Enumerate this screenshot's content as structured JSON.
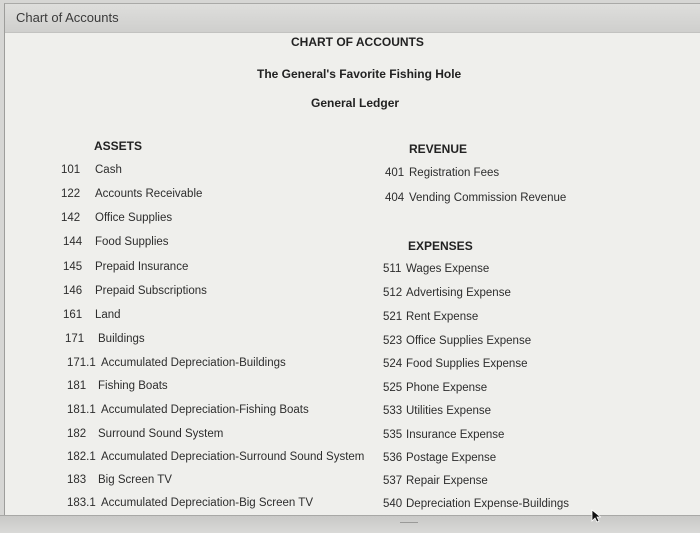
{
  "window": {
    "title": "Chart of Accounts"
  },
  "header": {
    "title": "CHART OF ACCOUNTS",
    "company": "The General's Favorite Fishing Hole",
    "ledger": "General Ledger"
  },
  "assets": {
    "heading": "ASSETS",
    "items": [
      {
        "num": "101",
        "name": "Cash"
      },
      {
        "num": "122",
        "name": "Accounts Receivable"
      },
      {
        "num": "142",
        "name": "Office Supplies"
      },
      {
        "num": "144",
        "name": "Food Supplies"
      },
      {
        "num": "145",
        "name": "Prepaid Insurance"
      },
      {
        "num": "146",
        "name": "Prepaid Subscriptions"
      },
      {
        "num": "161",
        "name": "Land"
      },
      {
        "num": "171",
        "name": "Buildings"
      },
      {
        "num": "171.1",
        "name": "Accumulated Depreciation-Buildings"
      },
      {
        "num": "181",
        "name": "Fishing Boats"
      },
      {
        "num": "181.1",
        "name": "Accumulated Depreciation-Fishing Boats"
      },
      {
        "num": "182",
        "name": "Surround Sound System"
      },
      {
        "num": "182.1",
        "name": "Accumulated Depreciation-Surround Sound System"
      },
      {
        "num": "183",
        "name": "Big Screen TV"
      },
      {
        "num": "183.1",
        "name": "Accumulated Depreciation-Big Screen TV"
      }
    ]
  },
  "revenue": {
    "heading": "REVENUE",
    "items": [
      {
        "num": "401",
        "name": "Registration Fees"
      },
      {
        "num": "404",
        "name": "Vending Commission Revenue"
      }
    ]
  },
  "expenses": {
    "heading": "EXPENSES",
    "items": [
      {
        "num": "511",
        "name": "Wages Expense"
      },
      {
        "num": "512",
        "name": "Advertising Expense"
      },
      {
        "num": "521",
        "name": "Rent Expense"
      },
      {
        "num": "523",
        "name": "Office Supplies Expense"
      },
      {
        "num": "524",
        "name": "Food Supplies Expense"
      },
      {
        "num": "525",
        "name": "Phone Expense"
      },
      {
        "num": "533",
        "name": "Utilities Expense"
      },
      {
        "num": "535",
        "name": "Insurance Expense"
      },
      {
        "num": "536",
        "name": "Postage Expense"
      },
      {
        "num": "537",
        "name": "Repair Expense"
      },
      {
        "num": "540",
        "name": "Depreciation Expense-Buildings"
      }
    ]
  }
}
